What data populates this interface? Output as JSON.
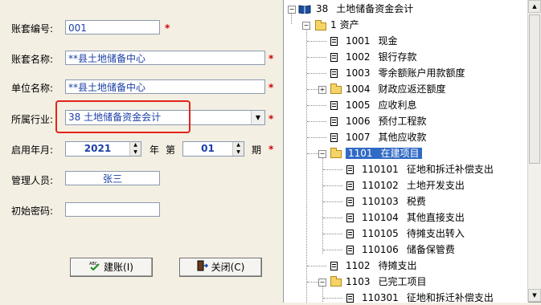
{
  "form": {
    "account_no": {
      "label": "账套编号:",
      "value": "001"
    },
    "account_name": {
      "label": "账套名称:",
      "value": "**县土地储备中心"
    },
    "unit_name": {
      "label": "单位名称:",
      "value": "**县土地储备中心"
    },
    "industry": {
      "label": "所属行业:",
      "value": "38 土地储备资金会计"
    },
    "start": {
      "label": "启用年月:",
      "year": "2021",
      "year_unit": "年",
      "period_prefix": "第",
      "period": "01",
      "period_unit": "期"
    },
    "manager": {
      "label": "管理人员:",
      "value": "张三"
    },
    "password": {
      "label": "初始密码:",
      "value": ""
    },
    "required_mark": "*"
  },
  "buttons": {
    "create": "建账(I)",
    "close": "关闭(C)"
  },
  "tree": {
    "root": {
      "code": "38",
      "name": "土地储备资金会计"
    },
    "group": {
      "code": "1",
      "name": "资产"
    },
    "nodes": [
      {
        "code": "1001",
        "name": "现金"
      },
      {
        "code": "1002",
        "name": "银行存款"
      },
      {
        "code": "1003",
        "name": "零余额账户用款额度"
      },
      {
        "code": "1004",
        "name": "财政应返还额度"
      },
      {
        "code": "1005",
        "name": "应收利息"
      },
      {
        "code": "1006",
        "name": "预付工程款"
      },
      {
        "code": "1007",
        "name": "其他应收款"
      },
      {
        "code": "1101",
        "name": "在建项目"
      },
      {
        "code": "110101",
        "name": "征地和拆迁补偿支出"
      },
      {
        "code": "110102",
        "name": "土地开发支出"
      },
      {
        "code": "110103",
        "name": "税费"
      },
      {
        "code": "110104",
        "name": "其他直接支出"
      },
      {
        "code": "110105",
        "name": "待摊支出转入"
      },
      {
        "code": "110106",
        "name": "储备保管费"
      },
      {
        "code": "1102",
        "name": "待摊支出"
      },
      {
        "code": "1103",
        "name": "已完工项目"
      },
      {
        "code": "110301",
        "name": "征地和拆迁补偿支出"
      }
    ]
  },
  "colors": {
    "accent": "#316ac5",
    "highlight_box": "#e2231a",
    "required": "#d00000",
    "value_text": "#1b3fa6"
  }
}
